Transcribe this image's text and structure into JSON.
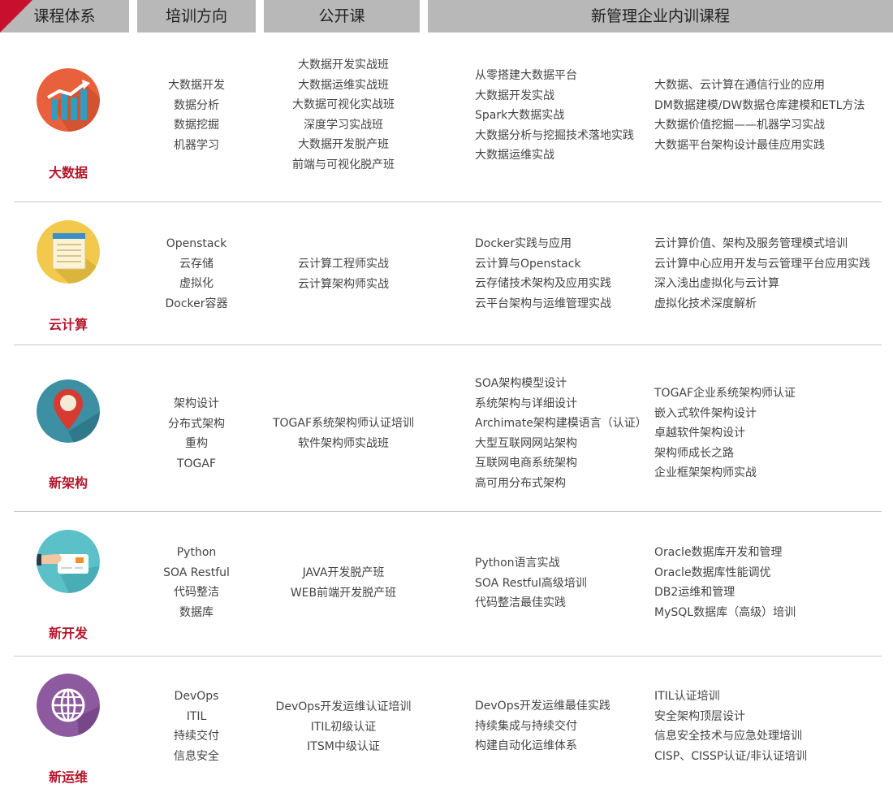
{
  "header": {
    "col1": "课程体系",
    "col2": "培训方向",
    "col3": "公开课",
    "col4": "新管理企业内训课程"
  },
  "colors": {
    "accent": "#c8102e",
    "header_bg": "#b8b8b8",
    "category_text": "#b5162b"
  },
  "rows": [
    {
      "category": "大数据",
      "icon": "chart-icon",
      "directions": [
        "大数据开发",
        "数据分析",
        "数据挖掘",
        "机器学习"
      ],
      "public": [
        "大数据开发实战班",
        "大数据运维实战班",
        "大数据可视化实战班",
        "深度学习实战班",
        "大数据开发脱产班",
        "前端与可视化脱产班"
      ],
      "inhouse_a": [
        "从零搭建大数据平台",
        "大数据开发实战",
        "Spark大数据实战",
        "大数据分析与挖掘技术落地实践",
        "大数据运维实战"
      ],
      "inhouse_b": [
        "大数据、云计算在通信行业的应用",
        "DM数据建模/DW数据仓库建模和ETL方法",
        "大数据价值挖掘——机器学习实战",
        "大数据平台架构设计最佳应用实践"
      ]
    },
    {
      "category": "云计算",
      "icon": "notepad-icon",
      "directions": [
        "Openstack",
        "云存储",
        "虚拟化",
        "Docker容器"
      ],
      "public": [
        "云计算工程师实战",
        "云计算架构师实战"
      ],
      "inhouse_a": [
        "Docker实践与应用",
        "云计算与Openstack",
        "云存储技术架构及应用实践",
        "云平台架构与运维管理实战"
      ],
      "inhouse_b": [
        "云计算价值、架构及服务管理模式培训",
        "云计算中心应用开发与云管理平台应用实践",
        "深入浅出虚拟化与云计算",
        "虚拟化技术深度解析"
      ]
    },
    {
      "category": "新架构",
      "icon": "map-pin-icon",
      "directions": [
        "架构设计",
        "分布式架构",
        "重构",
        "TOGAF"
      ],
      "public": [
        "TOGAF系统架构师认证培训",
        "软件架构师实战班"
      ],
      "inhouse_a": [
        "SOA架构模型设计",
        "系统架构与详细设计",
        "Archimate架构建模语言（认证）",
        "大型互联网网站架构",
        "互联网电商系统架构",
        "高可用分布式架构"
      ],
      "inhouse_b": [
        "TOGAF企业系统架构师认证",
        "嵌入式软件架构设计",
        "卓越软件架构设计",
        "架构师成长之路",
        "企业框架架构师实战"
      ]
    },
    {
      "category": "新开发",
      "icon": "card-hand-icon",
      "directions": [
        "Python",
        "SOA Restful",
        "代码整洁",
        "数据库"
      ],
      "public": [
        "JAVA开发脱产班",
        "WEB前端开发脱产班"
      ],
      "inhouse_a": [
        "Python语言实战",
        "SOA Restful高级培训",
        "代码整洁最佳实践"
      ],
      "inhouse_b": [
        "Oracle数据库开发和管理",
        "Oracle数据库性能调优",
        "DB2运维和管理",
        "MySQL数据库（高级）培训"
      ]
    },
    {
      "category": "新运维",
      "icon": "globe-icon",
      "directions": [
        "DevOps",
        "ITIL",
        "持续交付",
        "信息安全"
      ],
      "public": [
        "DevOps开发运维认证培训",
        "ITIL初级认证",
        "ITSM中级认证"
      ],
      "inhouse_a": [
        "DevOps开发运维最佳实践",
        "持续集成与持续交付",
        "构建自动化运维体系"
      ],
      "inhouse_b": [
        "ITIL认证培训",
        "安全架构顶层设计",
        "信息安全技术与应急处理培训",
        "CISP、CISSP认证/非认证培训"
      ]
    }
  ]
}
